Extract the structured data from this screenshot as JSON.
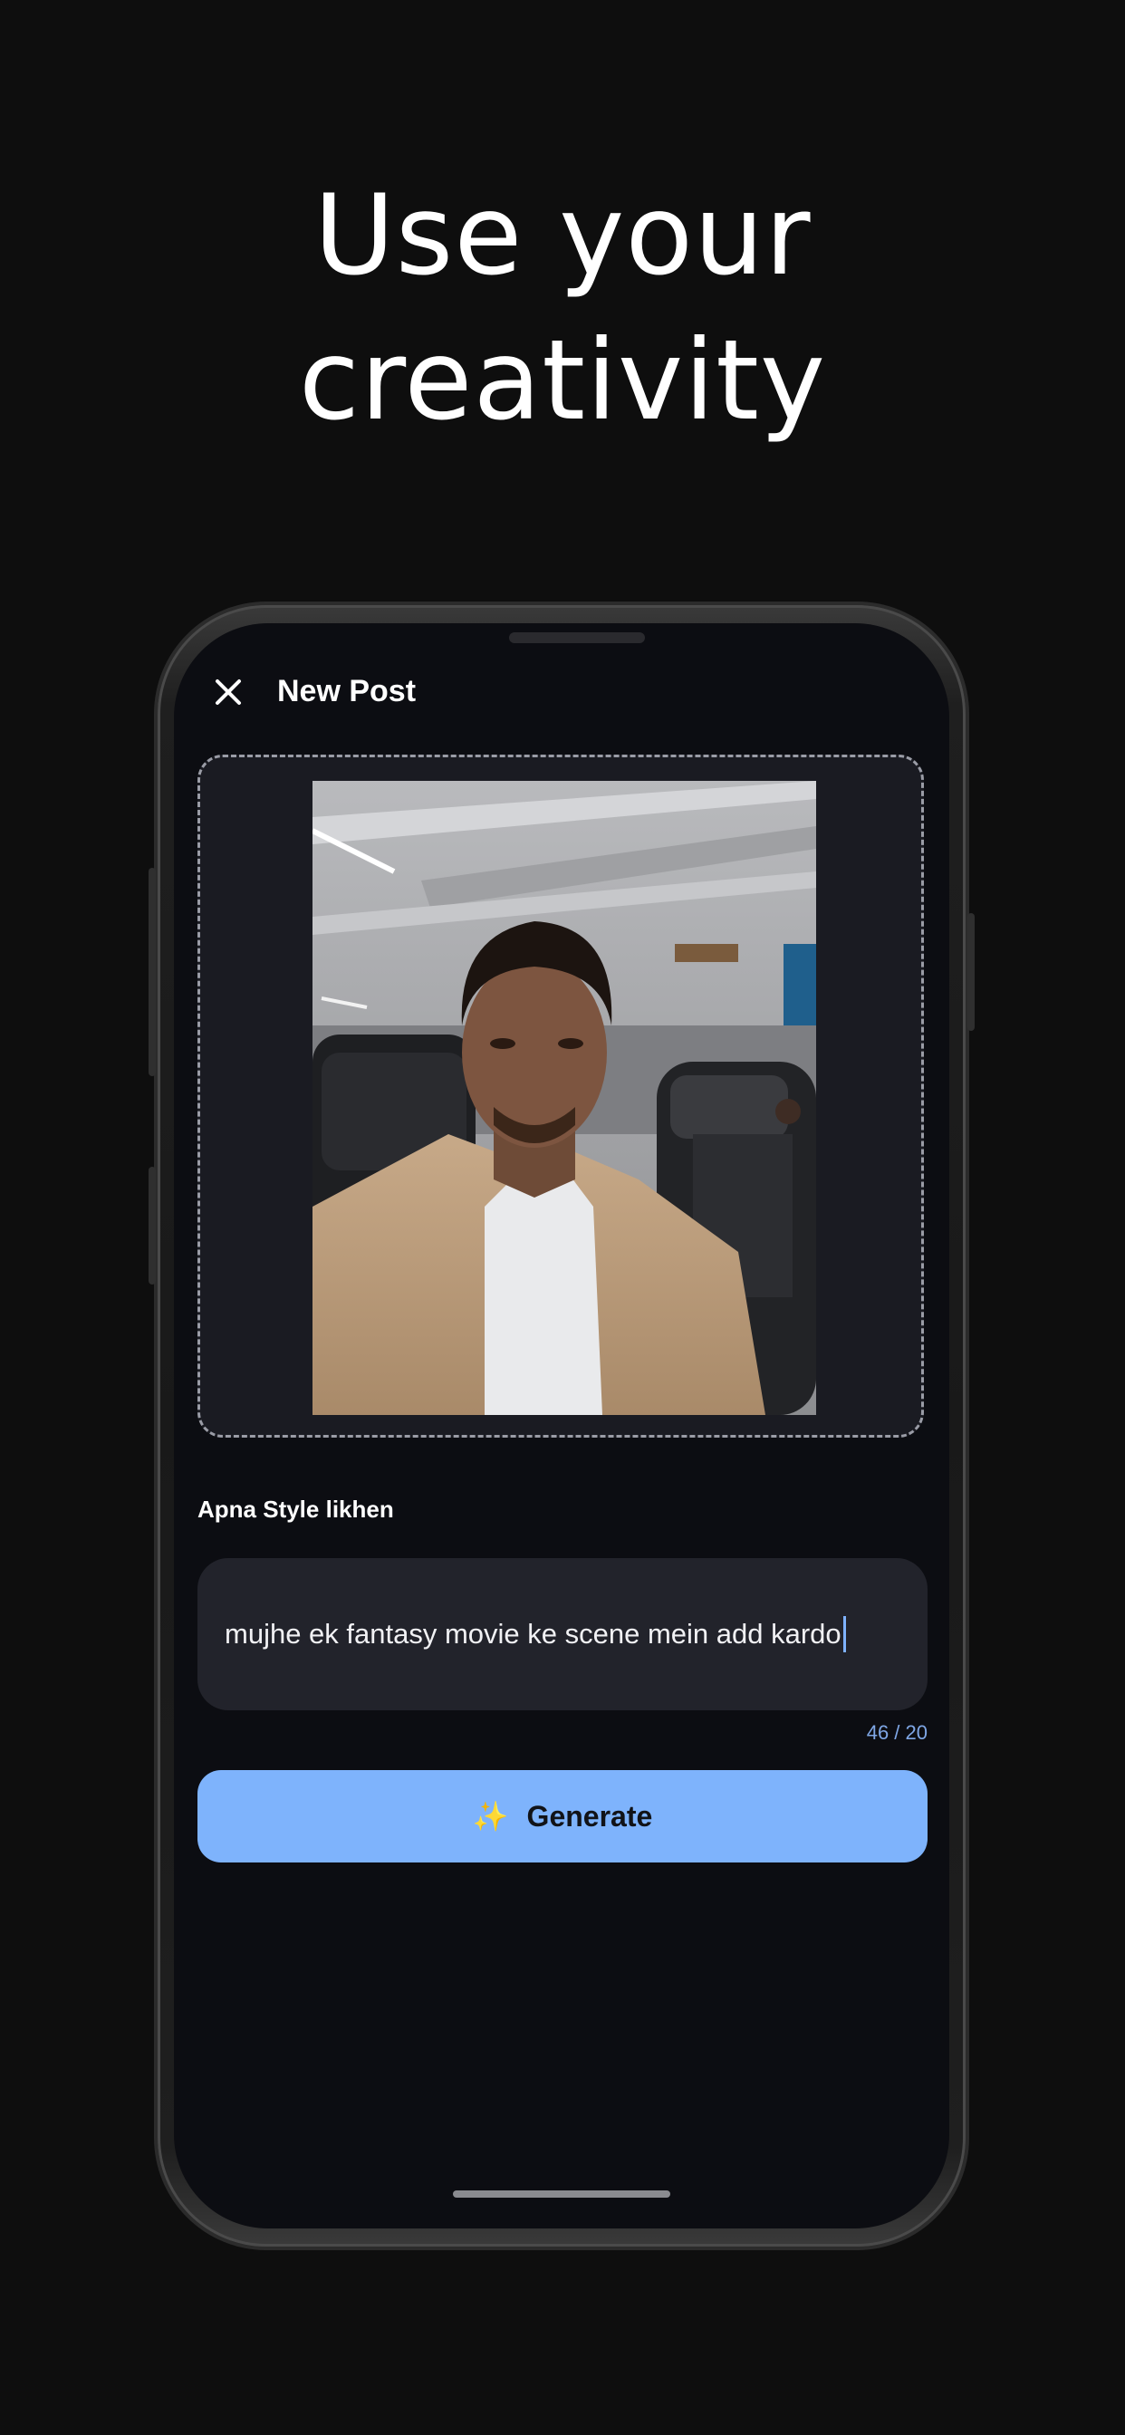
{
  "hero": {
    "line1": "Use your",
    "line2": "creativity"
  },
  "app": {
    "title": "New Post",
    "close_icon": "close-icon"
  },
  "upload": {
    "image_alt": "uploaded selfie photo"
  },
  "prompt": {
    "label": "Apna Style likhen",
    "value": "mujhe ek fantasy movie ke scene mein add kardo",
    "counter": "46 / 20"
  },
  "generate": {
    "icon": "sparkles-icon",
    "label": "Generate"
  },
  "colors": {
    "background": "#0e0e0e",
    "screen": "#0c0d12",
    "accent": "#7eb3fc",
    "counter": "#7fa7e6"
  }
}
